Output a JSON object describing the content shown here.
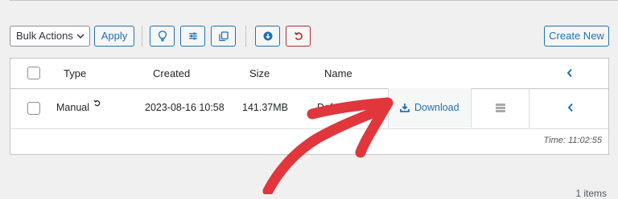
{
  "toolbar": {
    "bulk_actions_label": "Bulk Actions",
    "apply_label": "Apply",
    "create_new_label": "Create New",
    "icons": [
      "lightbulb-icon",
      "sliders-icon",
      "copy-icon",
      "download-circle-icon",
      "undo-icon"
    ]
  },
  "table": {
    "columns": {
      "type": "Type",
      "created": "Created",
      "size": "Size",
      "name": "Name"
    },
    "rows": [
      {
        "type": "Manual",
        "created": "2023-08-16 10:58",
        "size": "141.37MB",
        "name": "Default",
        "download_label": "Download"
      }
    ],
    "footer_time": "Time: 11:02:55"
  },
  "items_count": "1 items",
  "colors": {
    "accent": "#2271b1",
    "danger": "#b32d2e",
    "arrow": "#e0363c"
  }
}
